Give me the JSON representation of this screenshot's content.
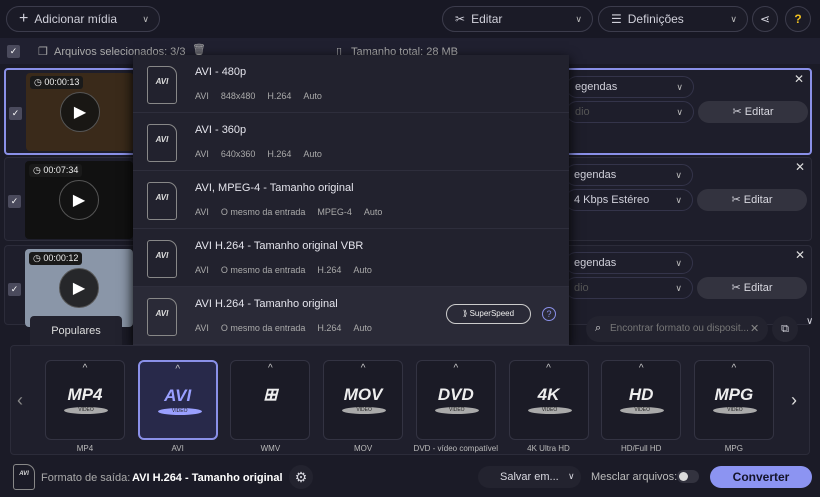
{
  "toolbar": {
    "add_media": "Adicionar mídia",
    "edit": "Editar",
    "settings": "Definições",
    "help": "?"
  },
  "selection": {
    "selected": "Arquivos selecionados: 3/3",
    "total": "Tamanho total: 28 MB"
  },
  "files": [
    {
      "duration": "00:00:13",
      "subtitles": "egendas",
      "audio": "dio",
      "edit": "Editar",
      "thumb": "#3a2a1a"
    },
    {
      "duration": "00:07:34",
      "subtitles": "egendas",
      "audio": "4 Kbps Estéreo",
      "edit": "Editar",
      "thumb": "#111111"
    },
    {
      "duration": "00:00:12",
      "subtitles": "egendas",
      "audio": "dio",
      "edit": "Editar",
      "thumb": "#8a96a8"
    }
  ],
  "presets": [
    {
      "icon": "AVI",
      "title": "AVI - 480p",
      "meta": [
        "AVI",
        "848x480",
        "H.264",
        "Auto"
      ]
    },
    {
      "icon": "AVI",
      "title": "AVI - 360p",
      "meta": [
        "AVI",
        "640x360",
        "H.264",
        "Auto"
      ]
    },
    {
      "icon": "AVI",
      "title": "AVI, MPEG-4 - Tamanho original",
      "meta": [
        "AVI",
        "O mesmo da entrada",
        "MPEG-4",
        "Auto"
      ]
    },
    {
      "icon": "AVI",
      "title": "AVI H.264 - Tamanho original VBR",
      "meta": [
        "AVI",
        "O mesmo da entrada",
        "H.264",
        "Auto"
      ]
    },
    {
      "icon": "AVI",
      "title": "AVI H.264 - Tamanho original",
      "meta": [
        "AVI",
        "O mesmo da entrada",
        "H.264",
        "Auto"
      ],
      "superspeed": "SuperSpeed"
    }
  ],
  "tabs": {
    "popular": "Populares"
  },
  "search": {
    "placeholder": "Encontrar formato ou disposit..."
  },
  "formats": [
    {
      "logo": "MP4",
      "label": "MP4"
    },
    {
      "logo": "AVI",
      "label": "AVI",
      "active": true
    },
    {
      "logo": "⊞",
      "label": "WMV"
    },
    {
      "logo": "MOV",
      "label": "MOV"
    },
    {
      "logo": "DVD",
      "label": "DVD - vídeo compatível"
    },
    {
      "logo": "4K",
      "label": "4K Ultra HD"
    },
    {
      "logo": "HD",
      "label": "HD/Full HD"
    },
    {
      "logo": "MPG",
      "label": "MPG"
    }
  ],
  "video_badge": "VIDEO",
  "footer": {
    "output_label": "Formato de saída:",
    "output_value": "AVI H.264 - Tamanho original",
    "save": "Salvar em...",
    "merge": "Mesclar arquivos:",
    "convert": "Converter"
  }
}
